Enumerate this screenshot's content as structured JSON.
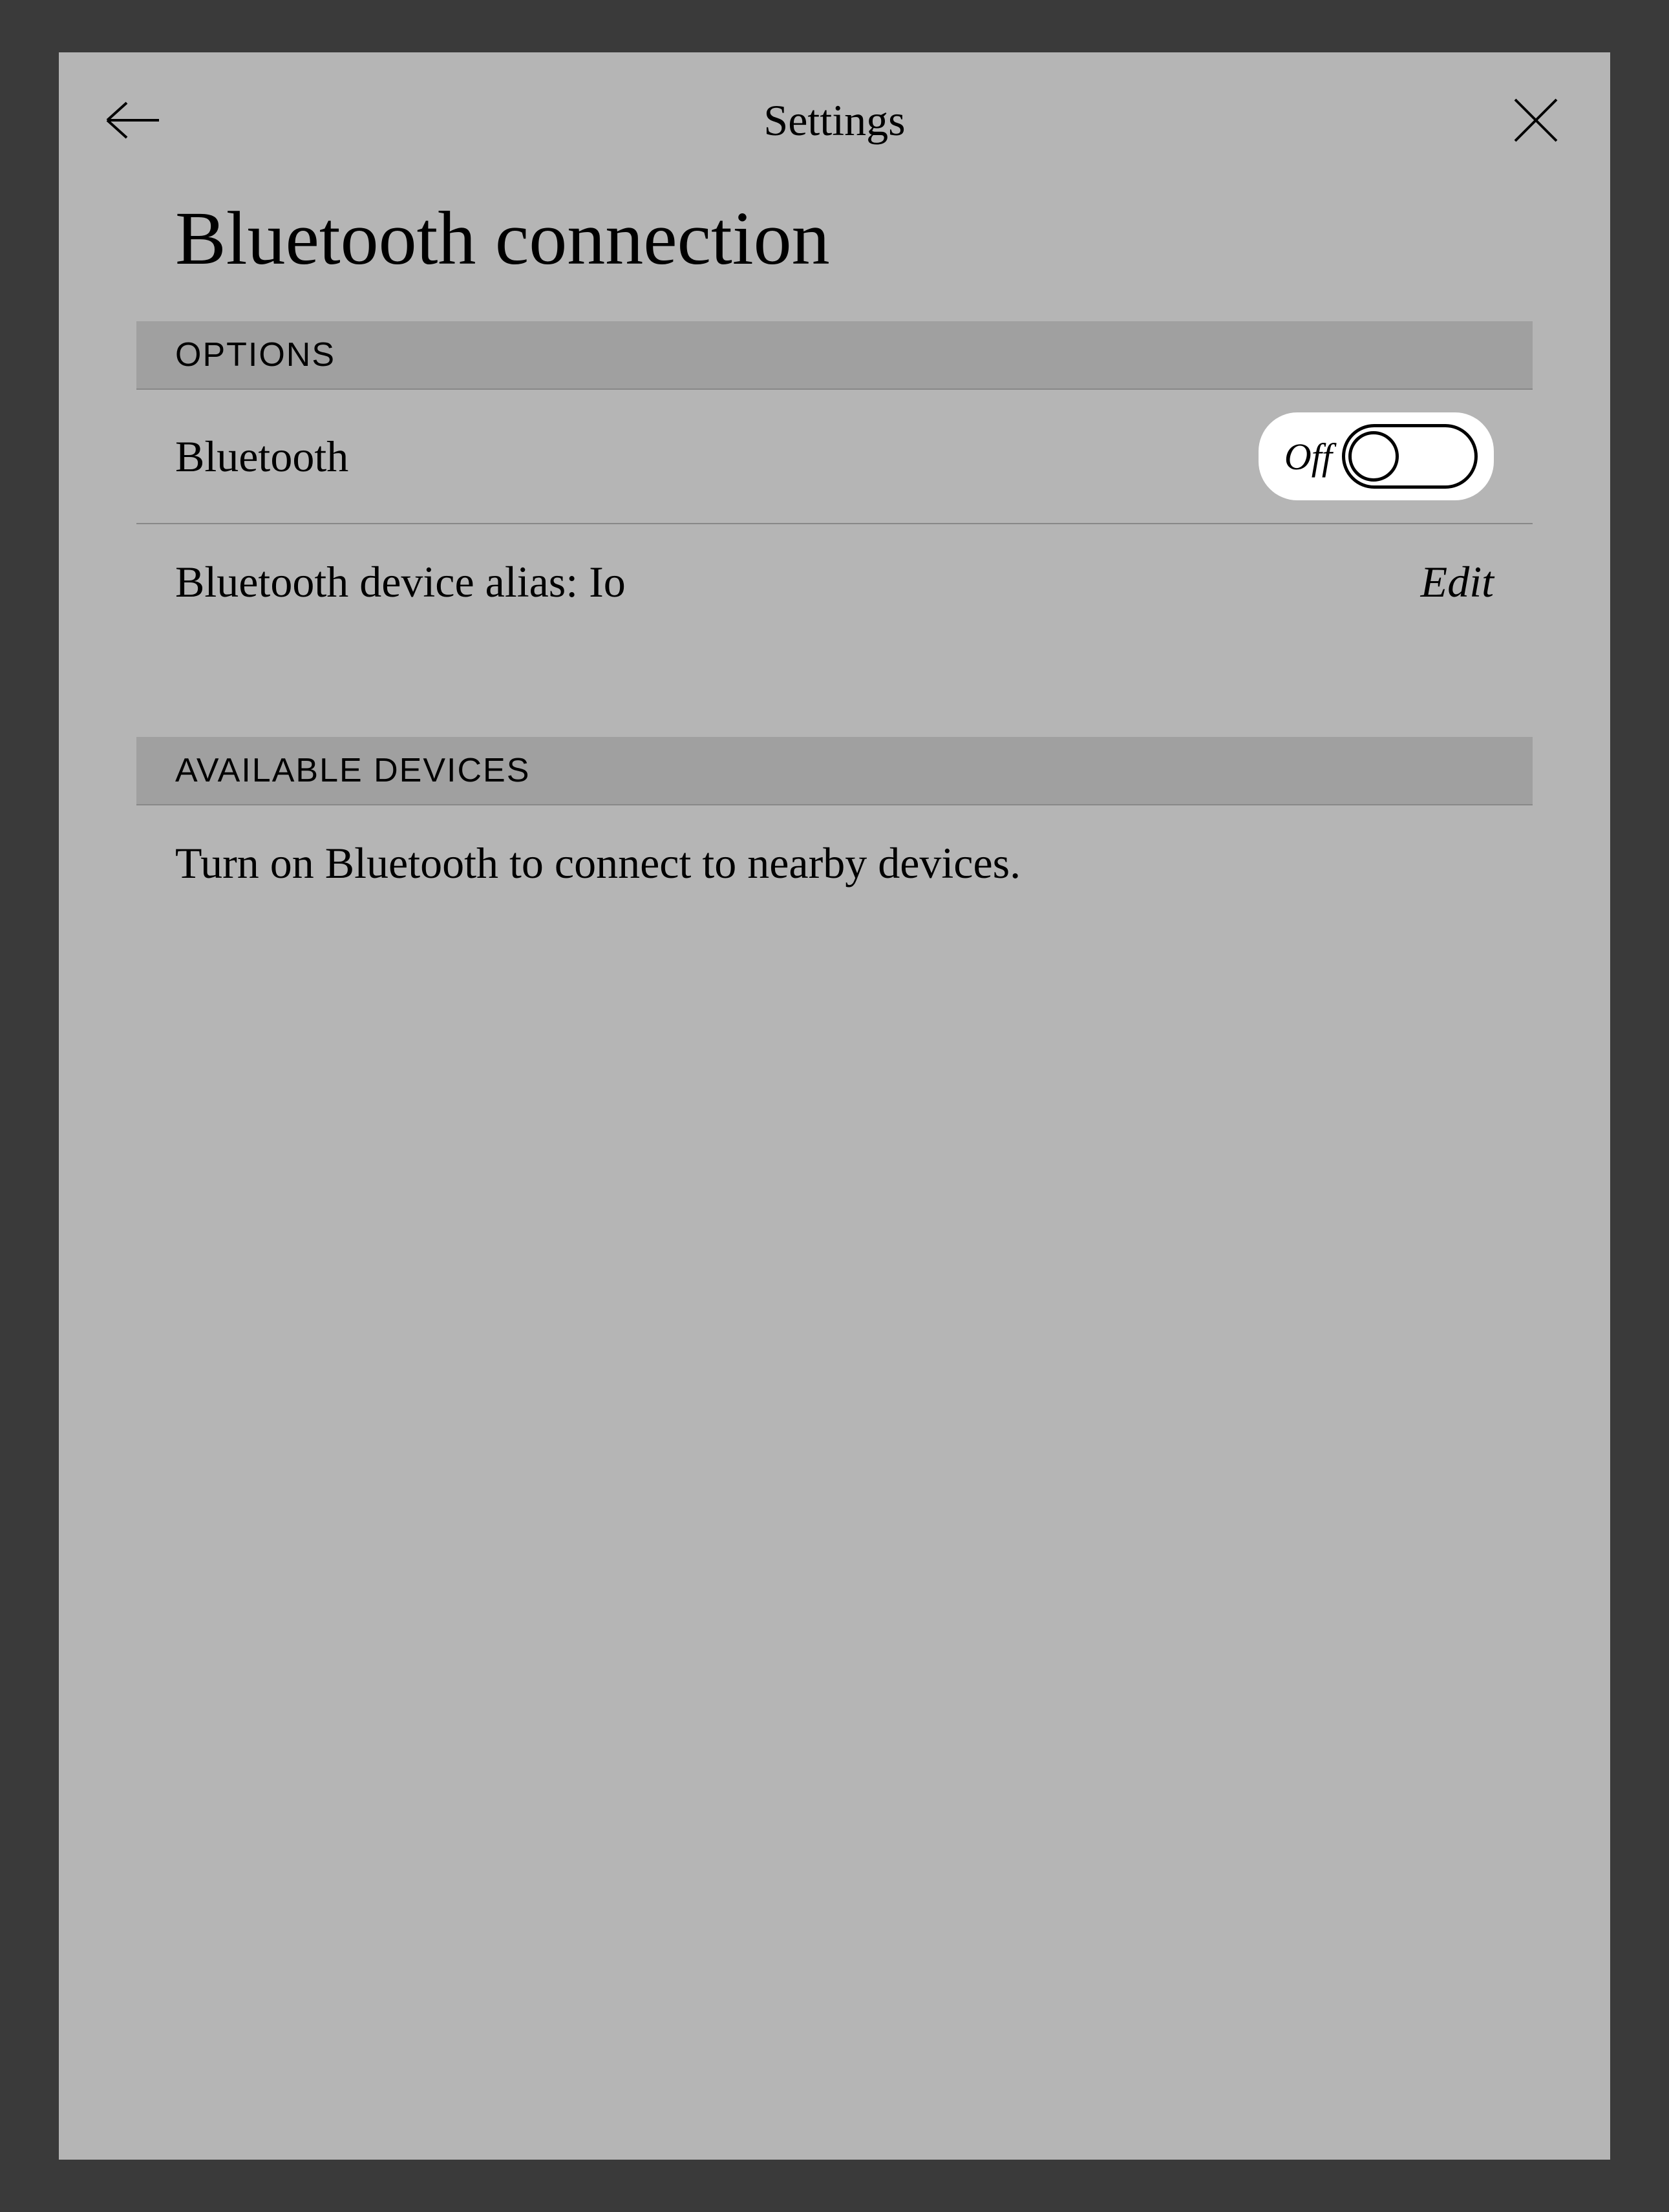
{
  "header": {
    "title": "Settings"
  },
  "page": {
    "title": "Bluetooth connection"
  },
  "sections": {
    "options": {
      "header": "OPTIONS",
      "bluetooth": {
        "label": "Bluetooth",
        "toggle_state": "Off"
      },
      "alias": {
        "label": "Bluetooth device alias: Io",
        "action": "Edit"
      }
    },
    "available": {
      "header": "AVAILABLE DEVICES",
      "info": "Turn on Bluetooth to connect to nearby devices."
    }
  }
}
